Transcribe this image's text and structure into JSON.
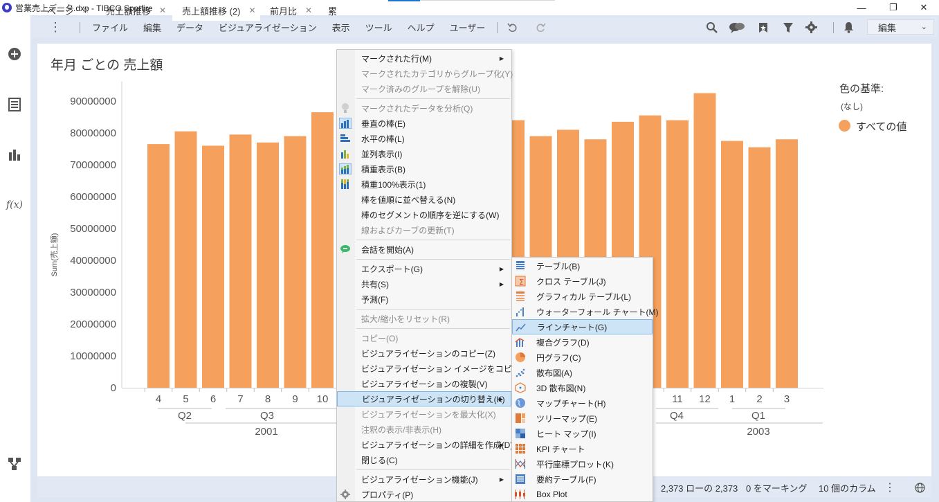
{
  "window": {
    "title": "営業売上データ.dxp - TIBCO Spotfire",
    "minimize": "—",
    "restore": "❐",
    "close": "✕"
  },
  "menubar": {
    "items": [
      "ファイル",
      "編集",
      "データ",
      "ビジュアライゼーション",
      "表示",
      "ツール",
      "ヘルプ",
      "ユーザー"
    ],
    "mode_label": "編集"
  },
  "visualization": {
    "title": "年月 ごとの 売上額",
    "legend_title": "色の基準:",
    "legend_subtitle": "(なし)",
    "legend_item": "すべての値",
    "bar_color": "#f5a05d"
  },
  "chart_data": {
    "type": "bar",
    "ylabel": "Sum(売上額)",
    "ylim": [
      0,
      95000000
    ],
    "yticks": [
      "0",
      "10000000",
      "20000000",
      "30000000",
      "40000000",
      "50000000",
      "60000000",
      "70000000",
      "80000000",
      "90000000"
    ],
    "ytick_values": [
      0,
      10000000,
      20000000,
      30000000,
      40000000,
      50000000,
      60000000,
      70000000,
      80000000,
      90000000
    ],
    "categories_left": [
      "4",
      "5",
      "6",
      "7",
      "8",
      "9",
      "10"
    ],
    "values_left": [
      76500000,
      80500000,
      76000000,
      79500000,
      77000000,
      79000000,
      86500000
    ],
    "categories_right": [
      "",
      "",
      "",
      "",
      "",
      "",
      "11",
      "12",
      "1",
      "2",
      "3"
    ],
    "values_right": [
      84000000,
      79000000,
      81000000,
      78000000,
      83500000,
      85500000,
      84000000,
      92500000,
      77500000,
      75500000,
      78000000
    ],
    "quarters": [
      "Q2",
      "Q3",
      "Q4",
      "Q1"
    ],
    "years": [
      "2001",
      "2003"
    ]
  },
  "context_menu": {
    "items": [
      {
        "label": "マークされた行(M)",
        "disabled": false,
        "arrow": true
      },
      {
        "label": "マークされたカテゴリからグループ化(Y)",
        "disabled": true
      },
      {
        "label": "マーク済みのグループを解除(U)",
        "disabled": true
      },
      {
        "label": "マークされたデータを分析(Q)",
        "disabled": true
      },
      {
        "label": "垂直の棒(E)",
        "disabled": false
      },
      {
        "label": "水平の棒(L)",
        "disabled": false
      },
      {
        "label": "並列表示(I)",
        "disabled": false
      },
      {
        "label": "積重表示(B)",
        "disabled": false
      },
      {
        "label": "積重100%表示(1)",
        "disabled": false
      },
      {
        "label": "棒を値順に並べ替える(N)",
        "disabled": false
      },
      {
        "label": "棒のセグメントの順序を逆にする(W)",
        "disabled": false
      },
      {
        "label": "線およびカーブの更新(T)",
        "disabled": true
      },
      {
        "label": "会話を開始(A)",
        "disabled": false
      },
      {
        "label": "エクスポート(G)",
        "disabled": false,
        "arrow": true
      },
      {
        "label": "共有(S)",
        "disabled": false,
        "arrow": true
      },
      {
        "label": "予測(F)",
        "disabled": false
      },
      {
        "label": "拡大/縮小をリセット(R)",
        "disabled": true
      },
      {
        "label": "コピー(O)",
        "disabled": true
      },
      {
        "label": "ビジュアライゼーションのコピー(Z)",
        "disabled": false
      },
      {
        "label": "ビジュアライゼーション イメージをコピー(Z)",
        "disabled": false
      },
      {
        "label": "ビジュアライゼーションの複製(V)",
        "disabled": false
      },
      {
        "label": "ビジュアライゼーションの切り替え(K)",
        "disabled": false,
        "arrow": true,
        "highlight": true
      },
      {
        "label": "ビジュアライゼーションを最大化(X)",
        "disabled": true
      },
      {
        "label": "注釈の表示/非表示(H)",
        "disabled": true
      },
      {
        "label": "ビジュアライゼーションの詳細を作成(D)",
        "disabled": false,
        "arrow": true
      },
      {
        "label": "閉じる(C)",
        "disabled": false
      },
      {
        "label": "ビジュアライゼーション機能(J)",
        "disabled": false,
        "arrow": true
      },
      {
        "label": "プロパティ(P)",
        "disabled": false
      }
    ]
  },
  "submenu": {
    "items": [
      {
        "label": "テーブル(B)"
      },
      {
        "label": "クロス テーブル(J)"
      },
      {
        "label": "グラフィカル テーブル(L)"
      },
      {
        "label": "ウォーターフォール チャート(M)"
      },
      {
        "label": "ラインチャート(G)",
        "highlight": true
      },
      {
        "label": "複合グラフ(D)"
      },
      {
        "label": "円グラフ(C)"
      },
      {
        "label": "散布図(A)"
      },
      {
        "label": "3D 散布図(N)"
      },
      {
        "label": "マップチャート(H)"
      },
      {
        "label": "ツリーマップ(E)"
      },
      {
        "label": "ヒート マップ(I)"
      },
      {
        "label": "KPI チャート"
      },
      {
        "label": "平行座標プロット(K)"
      },
      {
        "label": "要約テーブル(F)"
      },
      {
        "label": "Box Plot"
      }
    ]
  },
  "tabs": {
    "items": [
      "ページ",
      "売上額推移",
      "売上額推移 (2)",
      "前月比",
      "累"
    ],
    "close": "✕"
  },
  "statusbar": {
    "rows": "2,373 ローの 2,373",
    "marked": "0 をマーキング",
    "columns": "10 個のカラム"
  }
}
